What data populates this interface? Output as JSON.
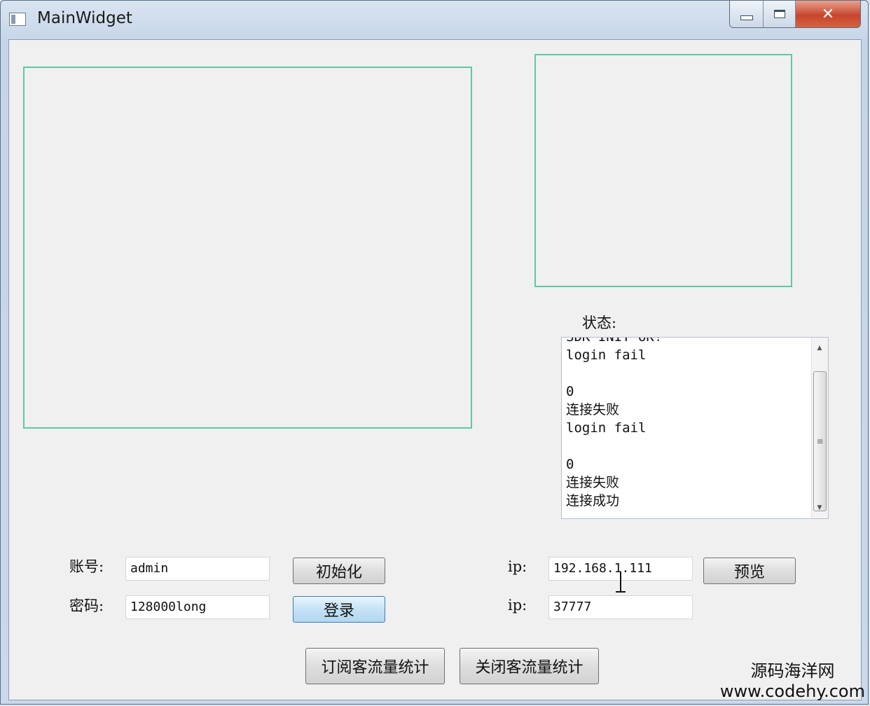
{
  "window": {
    "title": "MainWidget",
    "controls": {
      "minimize": "minimize",
      "maximize": "maximize",
      "close": "✕"
    }
  },
  "status": {
    "label": "状态:",
    "log": [
      "SDK INIT OK!",
      "login fail",
      "",
      "0",
      "连接失败",
      "login fail",
      "",
      "0",
      "连接失败",
      "连接成功"
    ]
  },
  "form": {
    "account_label": "账号:",
    "account_value": "admin",
    "password_label": "密码:",
    "password_value": "128000long",
    "init_button": "初始化",
    "login_button": "登录",
    "ip_label": "ip:",
    "ip_value": "192.168.1.111",
    "port_label": "ip:",
    "port_value": "37777",
    "preview_button": "预览"
  },
  "actions": {
    "subscribe_button": "订阅客流量统计",
    "close_button": "关闭客流量统计"
  },
  "watermark": {
    "line1": "源码海洋网",
    "line2": "www.codehy.com"
  },
  "colors": {
    "frame_border": "#5fc9a0",
    "client_bg": "#f0f0f0",
    "close_button": "#c8452d"
  }
}
